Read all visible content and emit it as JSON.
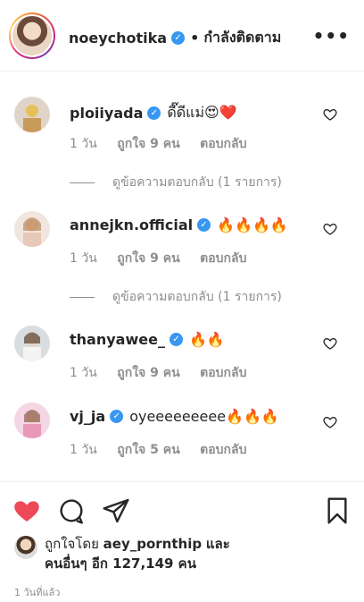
{
  "header": {
    "username": "noeychotika",
    "separator": "•",
    "follow_status": "กำลังติดตาม",
    "more_icon": "more-horizontal-icon"
  },
  "comments": [
    {
      "username": "ploiiyada",
      "text": "ดี๊ดีแม่😍❤️",
      "age": "1 วัน",
      "likes": "ถูกใจ 9 คน",
      "reply": "ตอบกลับ",
      "view_replies": "ดูข้อความตอบกลับ (1 รายการ)"
    },
    {
      "username": "annejkn.official",
      "text": "🔥🔥🔥🔥",
      "age": "1 วัน",
      "likes": "ถูกใจ 9 คน",
      "reply": "ตอบกลับ",
      "view_replies": "ดูข้อความตอบกลับ (1 รายการ)"
    },
    {
      "username": "thanyawee_",
      "text": "🔥🔥",
      "age": "1 วัน",
      "likes": "ถูกใจ 9 คน",
      "reply": "ตอบกลับ"
    },
    {
      "username": "vj_ja",
      "text": "oyeeeeeeeee🔥🔥🔥",
      "age": "1 วัน",
      "likes": "ถูกใจ 5 คน",
      "reply": "ตอบกลับ"
    }
  ],
  "actions": {
    "like_icon": "heart-filled-icon",
    "comment_icon": "comment-icon",
    "share_icon": "paper-plane-icon",
    "save_icon": "bookmark-icon"
  },
  "liked_by": {
    "prefix": "ถูกใจโดย",
    "user": "aey_pornthip",
    "conj": "และ",
    "others": "คนอื่นๆ อีก 127,149 คน"
  },
  "time_ago": "1 วันที่แล้ว",
  "colors": {
    "like_red": "#ed4956",
    "verified_blue": "#3897f0",
    "meta_gray": "#8e8e8e"
  }
}
